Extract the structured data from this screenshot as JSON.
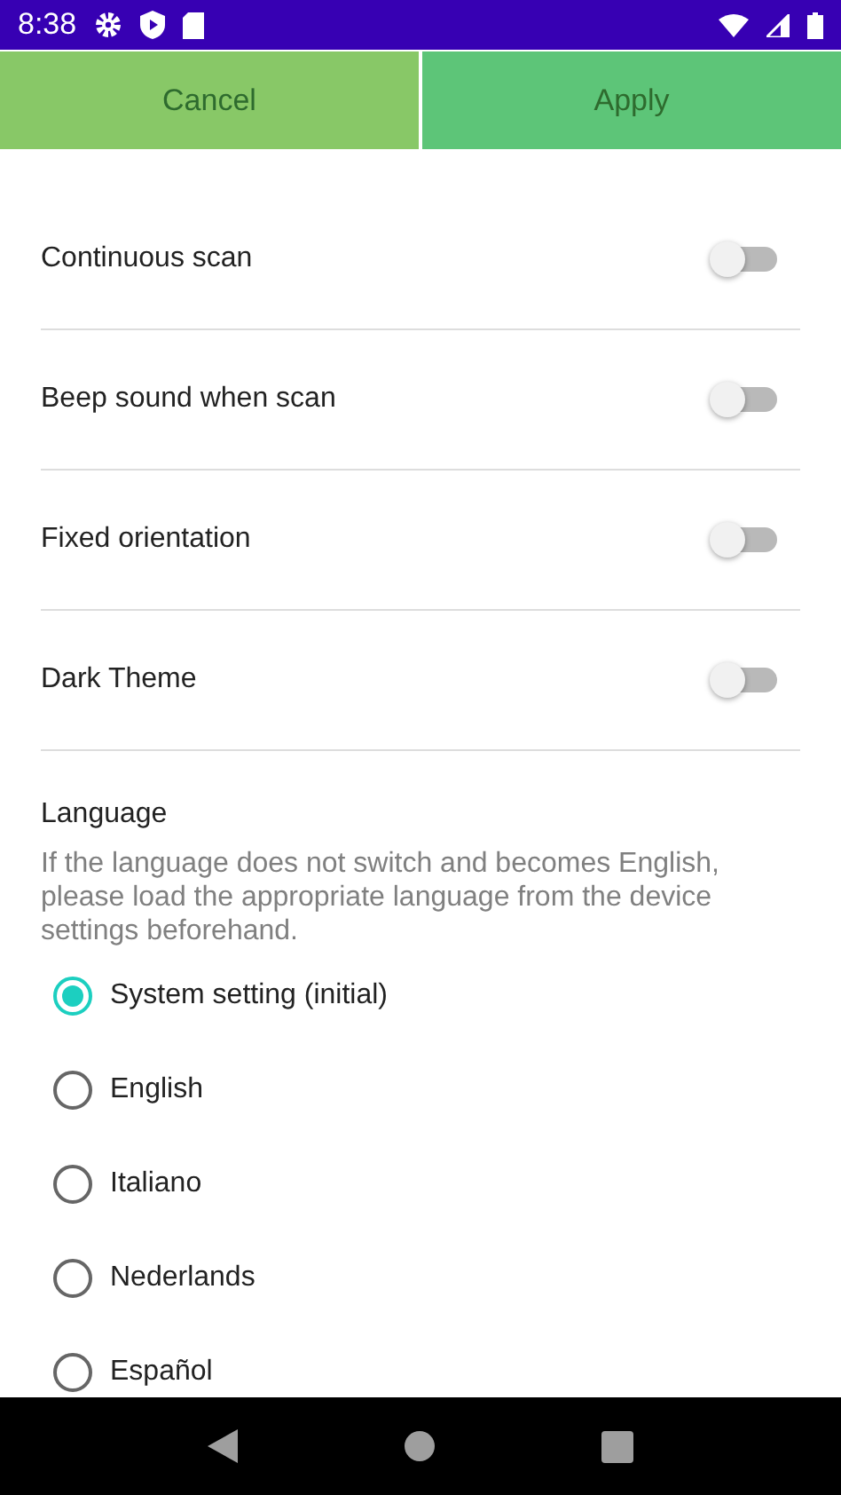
{
  "status_bar": {
    "time": "8:38"
  },
  "buttons": [
    {
      "label": "Cancel",
      "kind": "cancel"
    },
    {
      "label": "Apply",
      "kind": "apply"
    }
  ],
  "settings": [
    {
      "label": "Continuous scan",
      "on": false
    },
    {
      "label": "Beep sound when scan",
      "on": false
    },
    {
      "label": "Fixed orientation",
      "on": false
    },
    {
      "label": "Dark Theme",
      "on": false
    }
  ],
  "language": {
    "title": "Language",
    "note": "If the language does not switch and becomes English, please load the appropriate language from the device settings beforehand.",
    "options": [
      {
        "label": "System setting (initial)",
        "selected": true
      },
      {
        "label": "English",
        "selected": false
      },
      {
        "label": "Italiano",
        "selected": false
      },
      {
        "label": "Nederlands",
        "selected": false
      },
      {
        "label": "Español",
        "selected": false
      }
    ]
  }
}
